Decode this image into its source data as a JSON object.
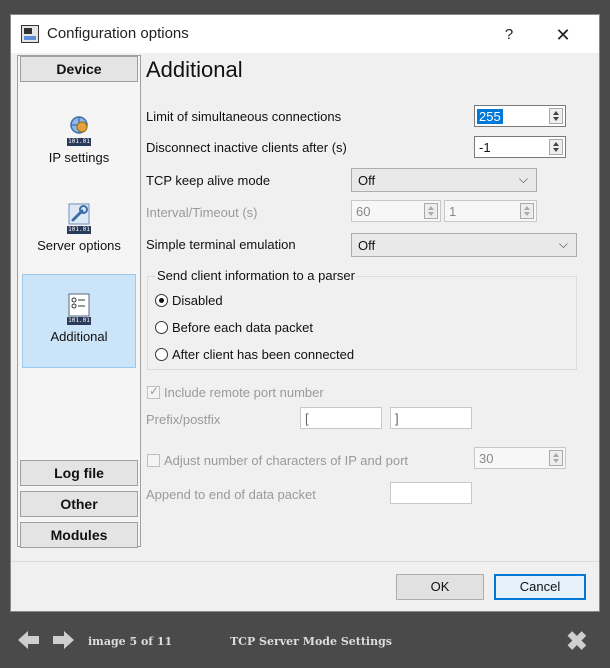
{
  "window": {
    "title": "Configuration options",
    "help": "?",
    "close": "✕"
  },
  "sidebar": {
    "device": "Device",
    "items": [
      {
        "label": "IP settings",
        "icon": "network-config-icon"
      },
      {
        "label": "Server options",
        "icon": "wrench-config-icon"
      },
      {
        "label": "Additional",
        "icon": "list-config-icon"
      }
    ],
    "log_file": "Log file",
    "other": "Other",
    "modules": "Modules"
  },
  "page": {
    "title": "Additional"
  },
  "fields": {
    "limit_label": "Limit of simultaneous connections",
    "limit_value": "255",
    "disconnect_label": "Disconnect inactive clients after (s)",
    "disconnect_value": "-1",
    "keepalive_label": "TCP keep alive mode",
    "keepalive_value": "Off",
    "interval_label": "Interval/Timeout (s)",
    "interval_value": "60",
    "timeout_value": "1",
    "terminal_label": "Simple terminal emulation",
    "terminal_value": "Off"
  },
  "group": {
    "title": "Send client information to a parser",
    "options": [
      "Disabled",
      "Before each data packet",
      "After client has been connected"
    ],
    "selected": 0
  },
  "extra": {
    "include_port": "Include remote port number",
    "prefix_label": "Prefix/postfix",
    "prefix_value": "[",
    "postfix_value": "]",
    "adjust_label": "Adjust number of characters of IP and port",
    "adjust_value": "30",
    "append_label": "Append to end of data packet",
    "append_value": ""
  },
  "buttons": {
    "ok": "OK",
    "cancel": "Cancel"
  },
  "viewer": {
    "counter": "image 5 of 11",
    "caption": "TCP Server Mode Settings",
    "prev": "🡸",
    "next": "🡺",
    "close": "✖"
  },
  "colors": {
    "accent": "#0078d7",
    "active_nav": "#cce4f7",
    "viewer_bg": "#4a4a4a"
  }
}
